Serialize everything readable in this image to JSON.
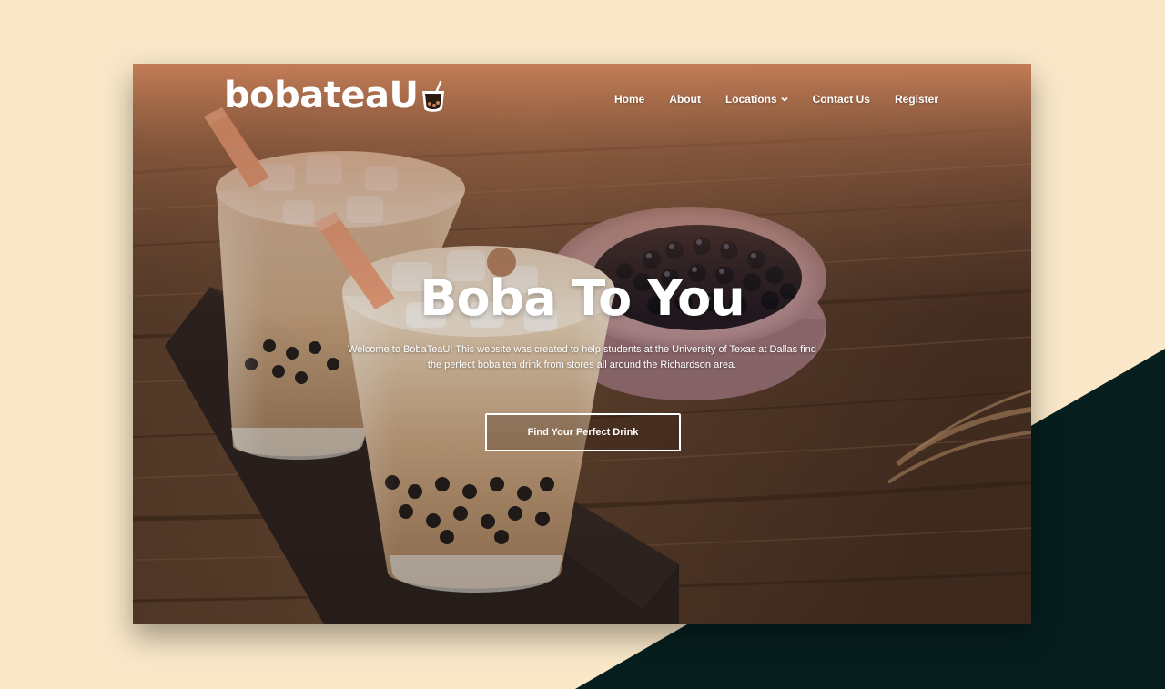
{
  "brand": {
    "logo_text": "bobateaU",
    "accent_color": "#c5835c",
    "corner_color": "#061f1e",
    "page_background": "#f9e7c8"
  },
  "nav": {
    "items": [
      {
        "label": "Home"
      },
      {
        "label": "About"
      },
      {
        "label": "Locations",
        "has_dropdown": true
      },
      {
        "label": "Contact Us"
      },
      {
        "label": "Register"
      }
    ]
  },
  "hero": {
    "title": "Boba To You",
    "description": "Welcome to BobaTeaU! This website was created to help students at the University of Texas at Dallas find the perfect boba tea drink from stores all around the Richardson area.",
    "cta_label": "Find Your Perfect Drink"
  },
  "icons": {
    "logo_mark": "boba-cup-icon",
    "dropdown": "chevron-down-icon"
  }
}
